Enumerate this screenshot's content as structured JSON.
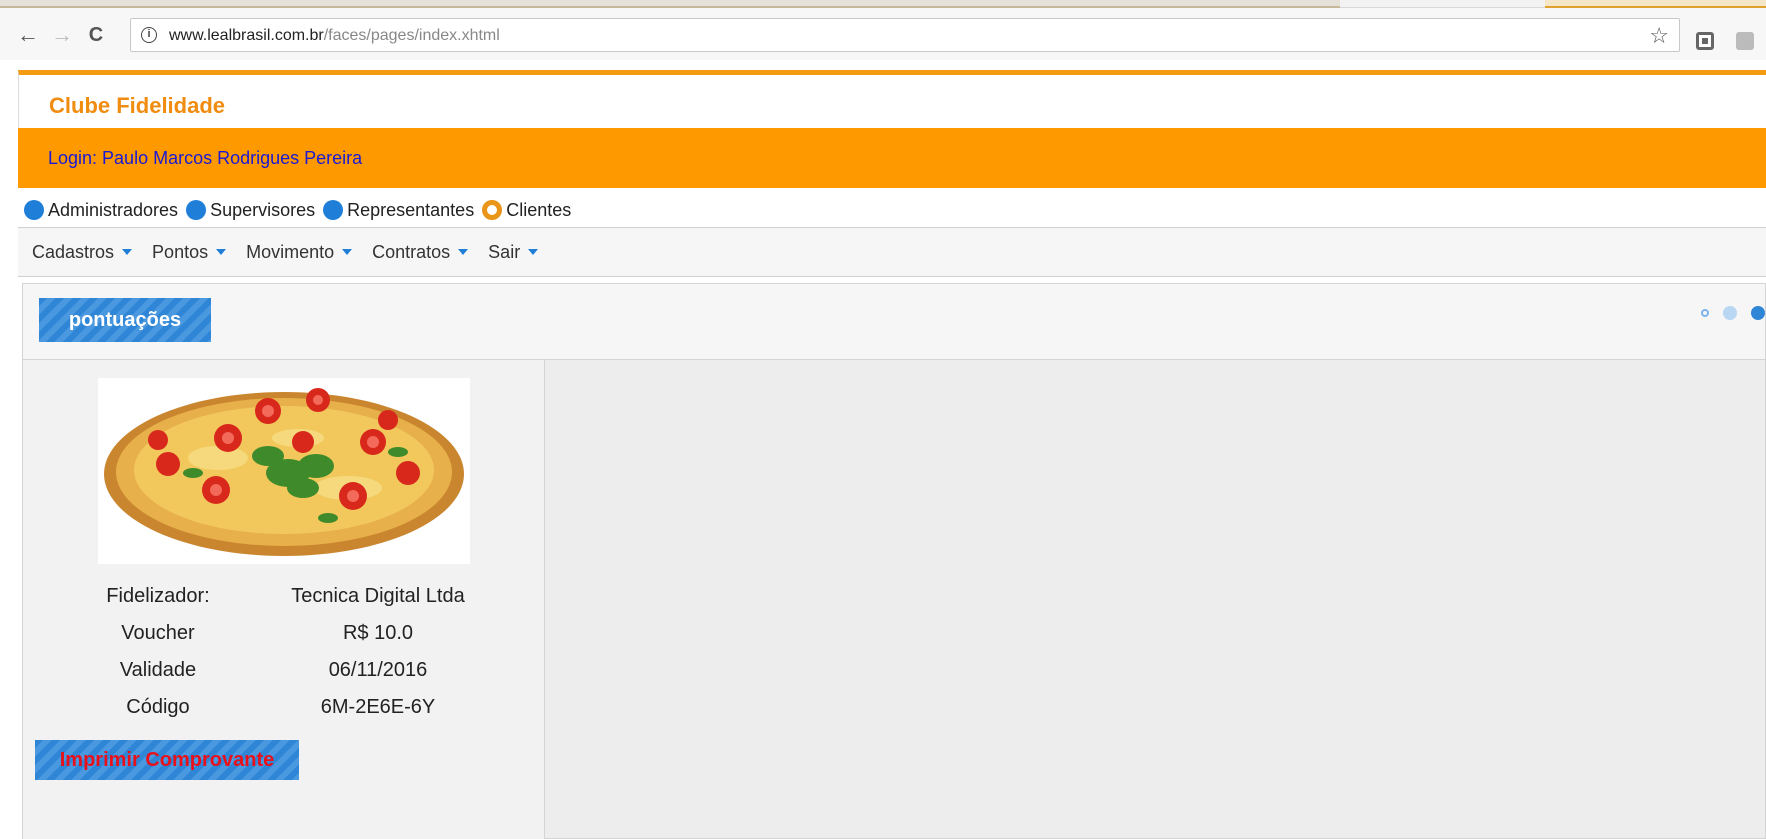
{
  "browser": {
    "url_host": "www.lealbrasil.com.br",
    "url_path": "/faces/pages/index.xhtml",
    "back_label": "←",
    "forward_label": "→",
    "reload_label": "C",
    "info_label": "i",
    "star_label": "☆"
  },
  "header": {
    "brand_title": "Clube Fidelidade",
    "login_text": "Login: Paulo Marcos Rodrigues Pereira"
  },
  "roles": [
    {
      "label": "Administradores",
      "selected": false
    },
    {
      "label": "Supervisores",
      "selected": false
    },
    {
      "label": "Representantes",
      "selected": false
    },
    {
      "label": "Clientes",
      "selected": true
    }
  ],
  "menu": [
    {
      "label": "Cadastros"
    },
    {
      "label": "Pontos"
    },
    {
      "label": "Movimento"
    },
    {
      "label": "Contratos"
    },
    {
      "label": "Sair"
    }
  ],
  "panel": {
    "title_button": "pontuações",
    "card": {
      "rows": [
        {
          "label": "Fidelizador:",
          "value": "Tecnica Digital Ltda"
        },
        {
          "label": "Voucher",
          "value": "R$ 10.0"
        },
        {
          "label": "Validade",
          "value": "06/11/2016"
        },
        {
          "label": "Código",
          "value": "6M-2E6E-6Y"
        }
      ],
      "print_button": "Imprimir Comprovante"
    }
  },
  "colors": {
    "accent_orange": "#ff9900",
    "login_text": "#1a1ad6",
    "button_blue": "#2f86d6",
    "print_text": "#e8101a"
  }
}
